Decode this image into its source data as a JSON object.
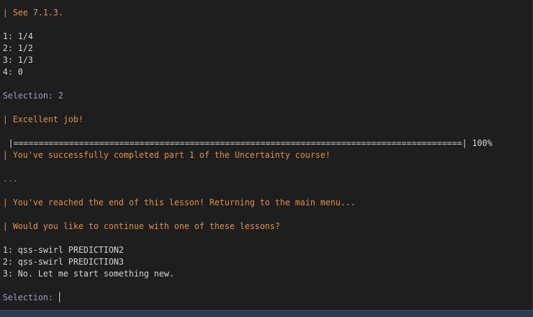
{
  "terminal": {
    "lines": {
      "see": "| See 7.1.3.",
      "opt1": "1: 1/4",
      "opt2": "2: 1/2",
      "opt3": "3: 1/3",
      "opt4": "4: 0",
      "selection1": "Selection: 2",
      "excellent": "| Excellent job!",
      "progress_bar": "|=========================================================================================| 100%",
      "completed": "| You've successfully completed part 1 of the Uncertainty course!",
      "ellipsis": "...",
      "end_lesson": "| You've reached the end of this lesson! Returning to the main menu...",
      "continue_q": "| Would you like to continue with one of these lessons?",
      "lesson1": "1: qss-swirl PREDICTION2",
      "lesson2": "2: qss-swirl PREDICTION3",
      "lesson3": "3: No. Let me start something new.",
      "selection_prompt": "Selection: "
    },
    "progress_percent": 100,
    "colors": {
      "background": "#1e1e1e",
      "message": "#e0914b",
      "prompt": "#a995c9",
      "text": "#d4d4d4",
      "status_bar": "#2b3e52"
    }
  }
}
